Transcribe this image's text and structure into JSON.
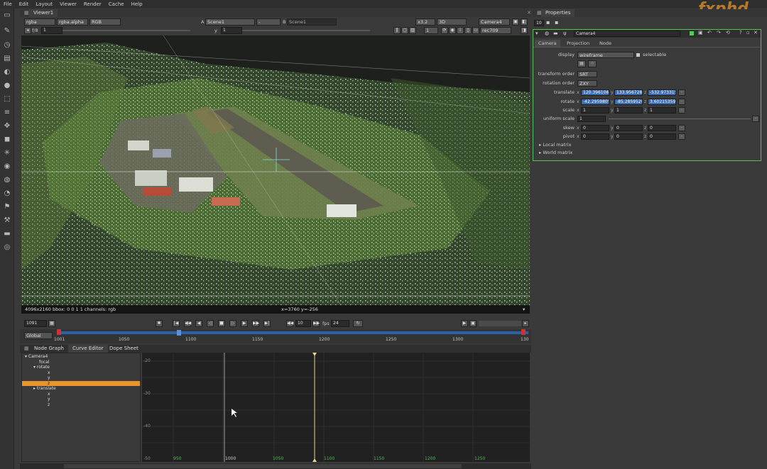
{
  "menu": [
    "File",
    "Edit",
    "Layout",
    "Viewer",
    "Render",
    "Cache",
    "Help"
  ],
  "watermark": "fxphd",
  "viewer": {
    "tab_label": "Viewer1",
    "channels": "rgba",
    "alpha": "rgba.alpha",
    "colorspace": "RGB",
    "input_a_label": "A",
    "input_a": "Scene1",
    "input_mid": "-",
    "input_b_label": "B",
    "input_b": "Scene1",
    "proxy": "x3.2",
    "view_mode": "3D",
    "camera": "Camera4",
    "lut": "rec709",
    "fstop": "f/8",
    "fstop_value": "1",
    "y_label": "y",
    "y_value": "1",
    "frame_skip": "1",
    "status_left": "4096x2160 bbox: 0 0 1 1 channels: rgb",
    "status_mid": "x=3760 y=-256"
  },
  "viewport": {
    "scene_note": "3D point cloud of a jungle airstrip"
  },
  "transport": {
    "frame": "1091",
    "increment": "10",
    "fps_label": "fps",
    "fps": "24",
    "timecode_scope": "Global",
    "ticks": [
      "1001",
      "1050",
      "1100",
      "1150",
      "1200",
      "1250",
      "1300",
      "130"
    ]
  },
  "bottom_tabs": [
    "Node Graph",
    "Curve Editor",
    "Dope Sheet"
  ],
  "curve_tree": [
    "Camera4",
    "focal",
    "rotate",
    "x",
    "y",
    "z",
    "translate",
    "x",
    "y",
    "z"
  ],
  "curve_y_ticks": [
    "-20",
    "-30",
    "-40",
    "-50"
  ],
  "curve_x_ticks": [
    "950",
    "1000",
    "1050",
    "1100",
    "1150",
    "1200",
    "1250"
  ],
  "properties": {
    "tab_label": "Properties",
    "max_panels": "10",
    "node_name": "Camera4",
    "subtabs": [
      "Camera",
      "Projection",
      "Node"
    ],
    "display_label": "display",
    "display_value": "wireframe",
    "selectable_label": "selectable",
    "transform_order_label": "transform order",
    "transform_order": "SRT",
    "rotation_order_label": "rotation order",
    "rotation_order": "ZXY",
    "translate_label": "translate",
    "translate": [
      "120.396106",
      "133.956728",
      "-532.973315"
    ],
    "rotate_label": "rotate",
    "rotate": [
      "-42.2959805",
      "-85.2859520",
      "3.60215359"
    ],
    "scale_label": "scale",
    "scale": [
      "1",
      "1",
      "1"
    ],
    "uniform_scale_label": "uniform scale",
    "uniform_scale": "1",
    "skew_label": "skew",
    "skew": [
      "0",
      "0",
      "0"
    ],
    "pivot_label": "pivot",
    "pivot": [
      "0",
      "0",
      "0"
    ],
    "local_matrix": "Local matrix",
    "world_matrix": "World matrix",
    "axis": [
      "x",
      "y",
      "z"
    ]
  }
}
